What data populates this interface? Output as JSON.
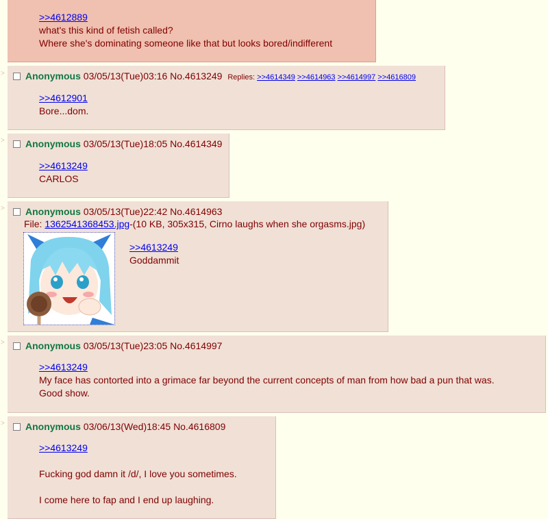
{
  "op_tail": {
    "quote": ">>4612889",
    "lines": [
      "what's this kind of fetish called?",
      "Where she's dominating someone like that but looks bored/indifferent"
    ]
  },
  "posts": [
    {
      "name": "Anonymous",
      "datetime": "03/05/13(Tue)03:16",
      "postno": "No.4613249",
      "replies_label": "Replies:",
      "replies": [
        ">>4614349",
        ">>4614963",
        ">>4614997",
        ">>4616809"
      ],
      "quote": ">>4612901",
      "lines": [
        "Bore...dom."
      ]
    },
    {
      "name": "Anonymous",
      "datetime": "03/05/13(Tue)18:05",
      "postno": "No.4614349",
      "quote": ">>4613249",
      "lines": [
        "CARLOS"
      ]
    },
    {
      "name": "Anonymous",
      "datetime": "03/05/13(Tue)22:42",
      "postno": "No.4614963",
      "file_label": "File:",
      "file_link": "1362541368453.jpg",
      "file_meta": "-(10 KB, 305x315, Cirno laughs when she orgasms.jpg)",
      "quote": ">>4613249",
      "lines": [
        "Goddammit"
      ]
    },
    {
      "name": "Anonymous",
      "datetime": "03/05/13(Tue)23:05",
      "postno": "No.4614997",
      "quote": ">>4613249",
      "lines": [
        "My face has contorted into a grimace far beyond the current concepts of man from how bad a pun that was.",
        "Good show."
      ]
    },
    {
      "name": "Anonymous",
      "datetime": "03/06/13(Wed)18:45",
      "postno": "No.4616809",
      "quote": ">>4613249",
      "lines": [
        "Fucking god damn it /d/, I love you sometimes.",
        "I come here to fap and I end up laughing."
      ]
    }
  ],
  "arrow_glyph": ">",
  "colors": {
    "page_bg": "#FFFFEE",
    "post_bg": "#F0E0D6",
    "highlight_bg": "#F0C0B0",
    "name": "#117743",
    "text": "#800000",
    "link": "#0000EE"
  }
}
